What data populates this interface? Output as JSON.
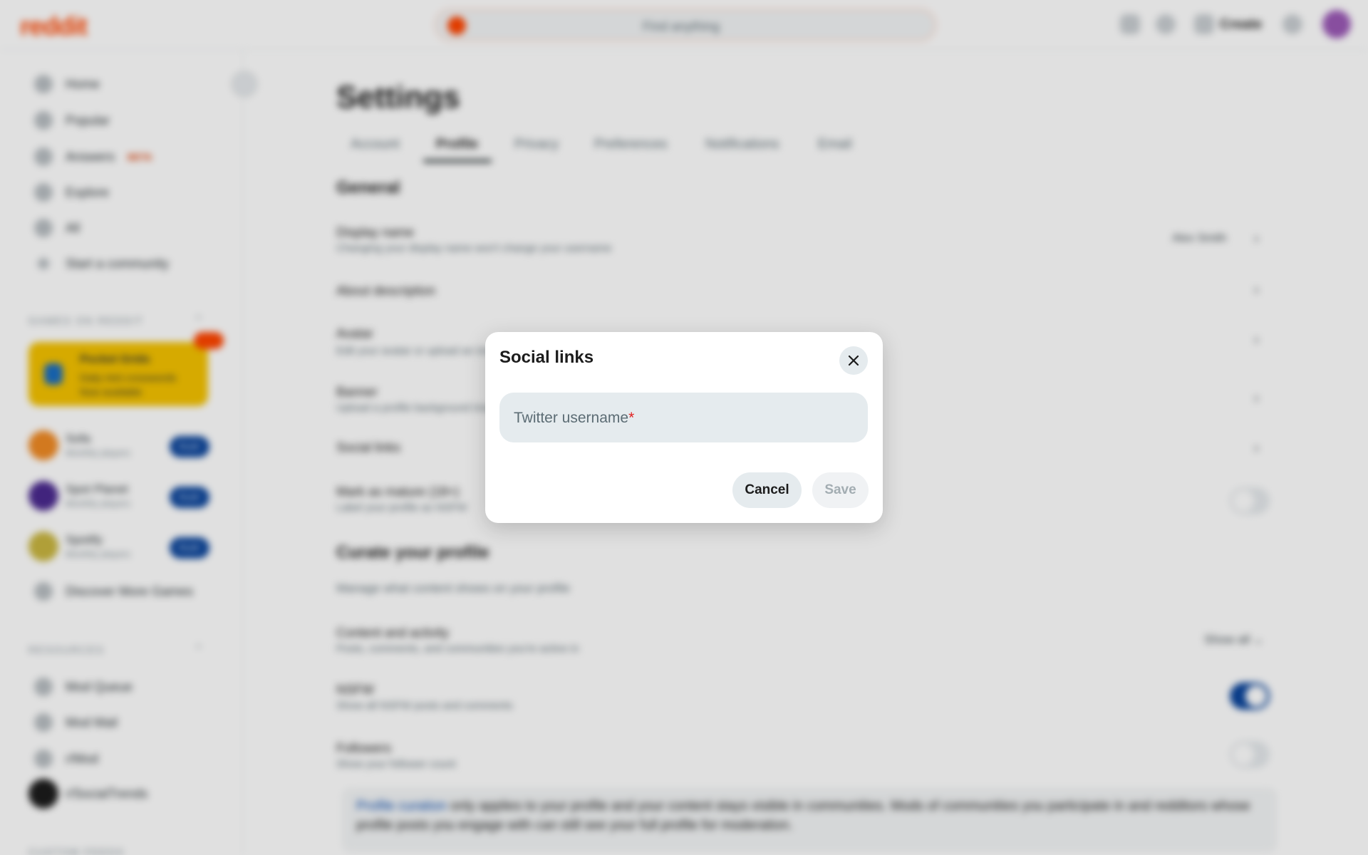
{
  "header": {
    "logo": "reddit",
    "search_placeholder": "Find anything",
    "create_label": "Create",
    "icons": [
      "advertise-icon",
      "chat-icon",
      "create-icon",
      "notifications-icon"
    ]
  },
  "sidebar": {
    "nav": [
      {
        "label": "Home",
        "icon": "home-icon"
      },
      {
        "label": "Popular",
        "icon": "popular-icon"
      },
      {
        "label": "Answers",
        "icon": "answers-icon",
        "badge": "BETA"
      },
      {
        "label": "Explore",
        "icon": "explore-icon"
      },
      {
        "label": "All",
        "icon": "all-icon"
      },
      {
        "label": "Start a community",
        "icon": "plus-icon"
      }
    ],
    "games_heading": "GAMES ON REDDIT",
    "promo": {
      "title": "Pocket Grids",
      "subtitle": "Daily mini crosswords",
      "line": "Now available"
    },
    "games": [
      {
        "name": "Sofa",
        "sub": "Monthly players",
        "action": "PLAY"
      },
      {
        "name": "Spot Planet",
        "sub": "Monthly players",
        "action": "PLAY"
      },
      {
        "name": "Spotify",
        "sub": "Monthly players",
        "action": "PLAY"
      }
    ],
    "discover": "Discover More Games",
    "resources_heading": "RESOURCES",
    "resources": [
      "Mod Queue",
      "Mod Mail",
      "r/Mod"
    ],
    "user_label": "r/SocialTrends",
    "bottom_heading": "CUSTOM FEEDS"
  },
  "settings": {
    "title": "Settings",
    "tabs": [
      "Account",
      "Profile",
      "Privacy",
      "Preferences",
      "Notifications",
      "Email"
    ],
    "active_tab": "Profile",
    "general_heading": "General",
    "rows": [
      {
        "title": "Display name",
        "sub": "Changing your display name won't change your username",
        "value": "Alex Smith"
      },
      {
        "title": "About description",
        "sub": ""
      },
      {
        "title": "Avatar",
        "sub": "Edit your avatar or upload an image"
      },
      {
        "title": "Banner",
        "sub": "Upload a profile background image"
      },
      {
        "title": "Social links",
        "sub": ""
      },
      {
        "title": "Mark as mature (18+)",
        "sub": "Label your profile as NSFW"
      }
    ],
    "curate_heading": "Curate your profile",
    "curate_sub": "Manage what content shows on your profile",
    "curate_rows": [
      {
        "title": "Content and activity",
        "sub": "Posts, comments, and communities you're active in",
        "value": "Show all"
      },
      {
        "title": "NSFW",
        "sub": "Show all NSFW posts and comments",
        "toggle": true
      },
      {
        "title": "Followers",
        "sub": "Show your follower count",
        "toggle": false
      }
    ],
    "banner_link": "Profile curation",
    "banner_text": " only applies to your profile and your content stays visible in communities. Mods of communities you participate in and redditors whose profile posts you engage with can still see your full profile for moderation."
  },
  "modal": {
    "title": "Social links",
    "field_label": "Twitter username",
    "required_mark": "*",
    "field_value": "",
    "cancel_label": "Cancel",
    "save_label": "Save"
  }
}
